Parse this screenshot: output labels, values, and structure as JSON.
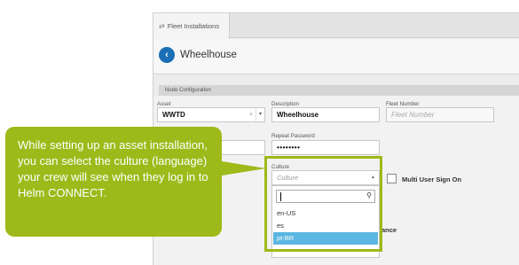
{
  "tab": {
    "icon": "fleet-icon",
    "label": "Fleet Installations"
  },
  "header": {
    "back_icon": "back-arrow-icon",
    "back_glyph": "‹",
    "title": "Wheelhouse"
  },
  "section": {
    "title": "Node Configuration"
  },
  "form": {
    "asset_label": "Asset",
    "asset_value": "WWTD",
    "asset_clear": "×",
    "asset_caret": "▾",
    "description_label": "Description",
    "description_value": "Wheelhouse",
    "fleet_number_label": "Fleet Number",
    "fleet_number_placeholder": "Fleet Number",
    "repeat_password_label": "Repeat Password",
    "repeat_password_value": "••••••••",
    "culture_label": "Culture",
    "culture_placeholder": "Culture",
    "culture_caret": "▴",
    "multi_user_label": "Multi User Sign On",
    "partial_label": "ance"
  },
  "dropdown": {
    "search_icon": "⚲",
    "options": [
      "en-US",
      "es",
      "pt-BR"
    ],
    "selected": "pt-BR"
  },
  "callout": {
    "text": "While setting up an asset installation, you can select the culture (language) your crew will see when they log in to Helm CONNECT."
  },
  "colors": {
    "accent": "#9dba1a",
    "selected": "#5bb6e3",
    "brand": "#1a6fb5"
  }
}
